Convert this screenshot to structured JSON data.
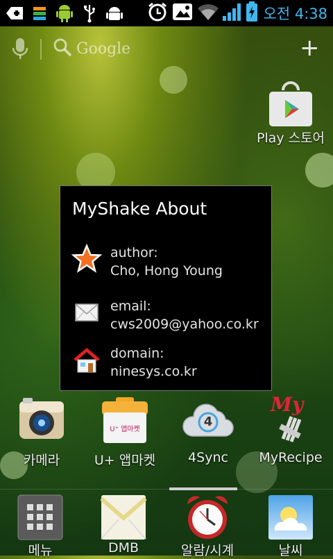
{
  "status_bar": {
    "icons": [
      "add-box-icon",
      "color-bars-icon",
      "android-robot-icon",
      "usb-icon",
      "android-debug-icon",
      "alarm-clock-icon",
      "gallery-icon",
      "wifi-icon",
      "signal-icon",
      "battery-charging-icon"
    ],
    "time": "오전 4:38",
    "accent_color": "#3fb7ee"
  },
  "search": {
    "label": "Google"
  },
  "play_store": {
    "label": "Play 스토어"
  },
  "dialog": {
    "title": "MyShake About",
    "rows": [
      {
        "icon": "star-icon",
        "label": "author:",
        "value": "Cho, Hong Young"
      },
      {
        "icon": "envelope-icon",
        "label": "email:",
        "value": "cws2009@yahoo.co.kr"
      },
      {
        "icon": "house-icon",
        "label": "domain:",
        "value": "ninesys.co.kr"
      }
    ]
  },
  "apps": [
    {
      "label": "카메라",
      "icon": "camera-icon"
    },
    {
      "label": "U+ 앱마켓",
      "icon": "uplus-market-icon",
      "icon_text": "U⁺ 앱마켓"
    },
    {
      "label": "4Sync",
      "icon": "4sync-cloud-icon",
      "icon_text": "4"
    },
    {
      "label": "MyRecipe",
      "icon": "myrecipe-icon",
      "icon_text": "My"
    }
  ],
  "dock": [
    {
      "label": "메뉴",
      "icon": "app-grid-icon"
    },
    {
      "label": "DMB",
      "icon": "dmb-envelope-icon"
    },
    {
      "label": "알람/시계",
      "icon": "alarm-clock-app-icon"
    },
    {
      "label": "날씨",
      "icon": "weather-icon"
    }
  ]
}
